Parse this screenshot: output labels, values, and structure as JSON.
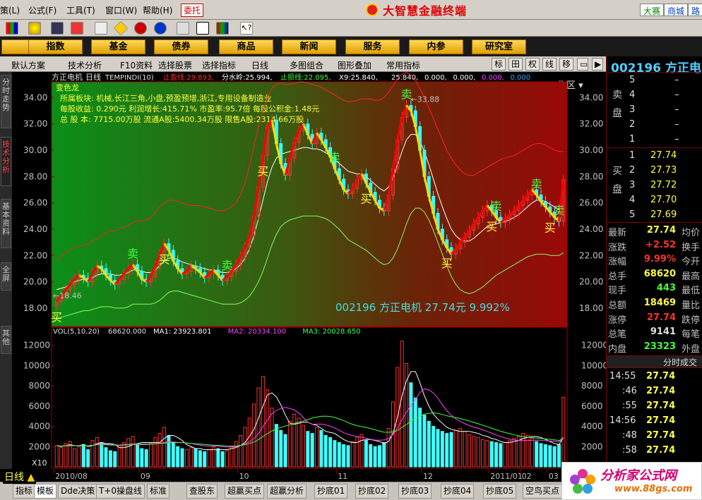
{
  "menu": {
    "items": [
      "策(L)",
      "公式(F)",
      "工具(T)",
      "窗口(W)",
      "帮助(H)"
    ],
    "weituo": "委托",
    "brand": "大智慧金融终端",
    "right_buttons": [
      "大赛",
      "商城",
      "路"
    ]
  },
  "navbar": {
    "items": [
      "指数",
      "基金",
      "债券",
      "商品",
      "新闻",
      "服务",
      "内参",
      "研究室"
    ],
    "workarea": "工作区"
  },
  "toolbar2": {
    "left_items": [
      "默认方案",
      "技术分析",
      "F10资料",
      "选择股票",
      "选择指标"
    ],
    "period": "日线",
    "mid_items": [
      "多图组合",
      "图形叠加",
      "常用指标"
    ],
    "right_buttons": [
      "标",
      "田",
      "权",
      "线",
      "移"
    ]
  },
  "side_tabs": [
    "分时走势",
    "技术分析",
    "基本资料",
    "全屏",
    "其他"
  ],
  "main_chart": {
    "header": {
      "name": "方正电机",
      "period": "日线",
      "indicator": "TEMPINDI(10)",
      "items": [
        {
          "label": "止盈线:",
          "value": "29.893",
          "color": "#ff3030"
        },
        {
          "label": "分水岭:",
          "value": "25.994",
          "color": "#ffffff"
        },
        {
          "label": "止损线:",
          "value": "22.095",
          "color": "#40ff40"
        },
        {
          "label": "X9:",
          "value": "25.840",
          "color": "#ffffff"
        },
        {
          "label": "",
          "value": "25.840",
          "color": "#ffffff"
        },
        {
          "label": "",
          "value": "0.000",
          "color": "#ffffff"
        },
        {
          "label": "",
          "value": "0.000",
          "color": "#ffffff"
        },
        {
          "label": "",
          "value": "0.000",
          "color": "#ff40ff"
        },
        {
          "label": "",
          "value": "0.000",
          "color": "#40a0ff"
        }
      ]
    },
    "info_lines": [
      "变色龙",
      "所属板块: 机械,长江三角,小盘,预盈预增,浙江,专用设备制造业",
      "每股收益: 0.290元   利润增长:415.71%   市盈率:95.7倍   每股公积金:1.48元",
      "总 股 本: 7715.00万股  流通A股:5400.34万股  限售A股:2314.66万股"
    ],
    "stock_label": "002196 方正电机 27.74元 9.992%",
    "low_mark": "←18.46",
    "high_mark": "←33.88",
    "buy_label": "买",
    "sell_label": "卖"
  },
  "chart_data": [
    {
      "type": "candlestick",
      "title": "方正电机 日线 TEMPINDI(10)",
      "y_ticks": [
        18.0,
        20.0,
        22.0,
        24.0,
        26.0,
        28.0,
        30.0,
        32.0,
        34.0
      ],
      "ylim": [
        16.6,
        35.2
      ],
      "x_months": [
        "2010/08",
        "09",
        "10",
        "11",
        "12",
        "2011/01",
        "02",
        "03"
      ],
      "close": [
        18.5,
        18.9,
        19.4,
        19.8,
        20.2,
        20.5,
        20.3,
        20.0,
        20.6,
        21.2,
        21.0,
        20.5,
        20.1,
        19.8,
        20.2,
        20.6,
        21.0,
        21.3,
        20.8,
        20.2,
        20.0,
        20.4,
        21.2,
        22.1,
        22.9,
        22.4,
        21.6,
        21.0,
        20.6,
        20.8,
        21.2,
        21.0,
        20.7,
        20.3,
        20.6,
        20.9,
        20.5,
        20.1,
        20.4,
        20.8,
        21.3,
        21.9,
        22.6,
        23.5,
        25.0,
        27.2,
        29.6,
        31.8,
        32.3,
        30.5,
        29.0,
        28.1,
        29.4,
        30.6,
        31.5,
        32.0,
        31.2,
        30.5,
        31.3,
        30.8,
        30.2,
        29.5,
        28.6,
        27.8,
        27.0,
        26.7,
        27.1,
        27.8,
        28.2,
        27.5,
        26.8,
        26.2,
        25.6,
        25.4,
        26.6,
        28.6,
        30.8,
        32.5,
        33.4,
        33.0,
        31.8,
        30.0,
        28.0,
        26.5,
        25.2,
        24.0,
        23.2,
        22.6,
        22.1,
        22.5,
        23.0,
        23.4,
        23.9,
        24.4,
        24.9,
        25.4,
        25.8,
        25.4,
        24.9,
        24.5,
        24.8,
        25.1,
        25.4,
        25.8,
        26.2,
        26.6,
        27.0,
        26.6,
        26.1,
        25.7,
        25.3,
        24.9,
        24.6,
        27.74
      ],
      "upper_band": [
        21.6,
        21.9,
        22.2,
        22.4,
        22.6,
        22.7,
        22.8,
        22.9,
        23.1,
        23.3,
        23.5,
        23.7,
        23.9,
        23.9,
        24.0,
        24.1,
        24.3,
        24.5,
        24.6,
        24.6,
        24.7,
        24.9,
        25.3,
        25.7,
        26.0,
        26.2,
        26.2,
        26.1,
        26.0,
        25.9,
        25.8,
        25.8,
        25.8,
        25.7,
        25.6,
        25.5,
        25.4,
        25.4,
        25.5,
        25.7,
        26.0,
        26.6,
        27.5,
        28.8,
        30.3,
        31.8,
        33.0,
        34.0,
        34.7,
        35.0,
        35.1,
        35.0,
        35.0,
        35.1,
        35.2,
        35.2,
        35.1,
        35.0,
        34.9,
        34.8,
        34.6,
        34.4,
        34.2,
        34.0,
        33.8,
        33.7,
        33.7,
        33.8,
        33.9,
        33.9,
        33.9,
        33.8,
        33.8,
        34.0,
        34.4,
        34.9,
        35.4,
        35.8,
        35.9,
        35.7,
        35.3,
        34.7,
        34.0,
        33.2,
        32.4,
        31.6,
        30.8,
        30.0,
        29.4,
        28.9,
        28.5,
        28.2,
        28.1,
        28.1,
        28.3,
        28.5,
        28.7,
        28.9,
        29.1,
        29.3,
        29.4,
        29.5,
        29.6,
        29.8,
        30.0,
        30.2,
        30.4,
        30.5,
        30.5,
        30.4,
        30.2,
        30.0,
        29.9,
        29.9
      ],
      "mid_line": [
        19.4,
        19.5,
        19.6,
        19.8,
        20.0,
        20.1,
        20.2,
        20.2,
        20.3,
        20.5,
        20.6,
        20.6,
        20.6,
        20.5,
        20.5,
        20.6,
        20.7,
        20.9,
        20.9,
        20.8,
        20.7,
        20.7,
        20.9,
        21.2,
        21.6,
        21.8,
        21.8,
        21.7,
        21.5,
        21.4,
        21.3,
        21.2,
        21.1,
        21.0,
        20.9,
        20.9,
        20.8,
        20.7,
        20.7,
        20.8,
        21.0,
        21.3,
        21.8,
        22.5,
        23.5,
        24.8,
        26.2,
        27.6,
        28.7,
        29.4,
        29.7,
        29.8,
        29.9,
        30.0,
        30.1,
        30.2,
        30.2,
        30.1,
        30.1,
        30.0,
        29.8,
        29.6,
        29.3,
        29.0,
        28.7,
        28.4,
        28.3,
        28.2,
        28.2,
        28.0,
        27.7,
        27.4,
        27.1,
        26.9,
        27.2,
        27.9,
        28.9,
        29.9,
        30.8,
        31.2,
        31.2,
        30.7,
        29.9,
        28.9,
        27.8,
        26.7,
        25.7,
        24.8,
        24.0,
        23.5,
        23.2,
        23.1,
        23.1,
        23.3,
        23.6,
        23.9,
        24.2,
        24.3,
        24.4,
        24.5,
        24.6,
        24.7,
        24.9,
        25.1,
        25.4,
        25.7,
        26.0,
        26.2,
        26.2,
        26.1,
        25.9,
        25.7,
        25.5,
        25.8
      ],
      "lower_band": [
        17.2,
        17.3,
        17.4,
        17.5,
        17.6,
        17.7,
        17.8,
        17.8,
        17.9,
        18.0,
        18.1,
        18.1,
        18.1,
        18.0,
        18.0,
        18.0,
        18.1,
        18.3,
        18.3,
        18.3,
        18.3,
        18.3,
        18.4,
        18.6,
        18.9,
        19.2,
        19.3,
        19.3,
        19.2,
        19.1,
        19.0,
        18.9,
        18.8,
        18.7,
        18.6,
        18.5,
        18.4,
        18.3,
        18.3,
        18.3,
        18.3,
        18.4,
        18.6,
        18.9,
        19.4,
        20.0,
        20.8,
        21.8,
        22.8,
        23.6,
        24.2,
        24.5,
        24.7,
        24.8,
        24.9,
        25.0,
        25.0,
        25.0,
        25.0,
        24.9,
        24.8,
        24.6,
        24.3,
        24.0,
        23.6,
        23.2,
        23.0,
        22.8,
        22.6,
        22.4,
        22.1,
        21.8,
        21.5,
        21.3,
        21.4,
        21.8,
        22.5,
        23.4,
        24.4,
        25.2,
        25.6,
        25.6,
        25.3,
        24.7,
        23.9,
        23.0,
        22.1,
        21.2,
        20.4,
        19.8,
        19.4,
        19.2,
        19.1,
        19.2,
        19.4,
        19.6,
        19.9,
        20.2,
        20.5,
        20.7,
        20.9,
        21.1,
        21.3,
        21.5,
        21.7,
        21.9,
        22.0,
        22.1,
        22.1,
        22.1,
        22.0,
        22.0,
        22.0,
        22.2
      ],
      "buy_points": [
        0,
        24,
        46,
        69,
        87,
        97,
        110
      ],
      "sell_points": [
        17,
        38,
        62,
        78,
        98,
        107,
        112
      ]
    },
    {
      "type": "bar",
      "title": "VOL(5,10,20)",
      "series": [
        {
          "name": "VOL",
          "last": "68620.000"
        },
        {
          "name": "MA1",
          "last": "23923.801"
        },
        {
          "name": "MA2",
          "last": "20334.100"
        },
        {
          "name": "MA3",
          "last": "20028.650"
        }
      ],
      "y_ticks": [
        2000,
        4000,
        6000,
        8000,
        10000,
        12000
      ],
      "ylim": [
        0,
        12800
      ],
      "unit_label": "X10",
      "values": [
        2100,
        1900,
        2300,
        2500,
        1800,
        2000,
        2200,
        1700,
        2600,
        2900,
        2400,
        1900,
        1600,
        1500,
        2100,
        2400,
        2800,
        3000,
        2200,
        1800,
        1700,
        2300,
        2900,
        3300,
        3900,
        3100,
        2400,
        2000,
        1800,
        1700,
        1900,
        1800,
        1600,
        1500,
        1700,
        2000,
        1800,
        1500,
        1600,
        2000,
        2500,
        3100,
        3900,
        4800,
        6200,
        7800,
        8900,
        7600,
        5800,
        4200,
        3600,
        3200,
        4500,
        5200,
        4800,
        4100,
        3500,
        3300,
        3900,
        3600,
        3100,
        2900,
        2600,
        2400,
        2200,
        2100,
        2500,
        2900,
        3200,
        2600,
        2200,
        2000,
        2100,
        2400,
        3800,
        6400,
        9800,
        12400,
        10200,
        8300,
        6800,
        5800,
        5100,
        4500,
        4000,
        3700,
        3500,
        3300,
        3400,
        3600,
        3800,
        3500,
        3200,
        3000,
        2900,
        2700,
        2600,
        2500,
        2400,
        2300,
        2400,
        2600,
        2800,
        3000,
        3300,
        3100,
        2800,
        2500,
        2300,
        2200,
        2100,
        2000,
        2200,
        6862
      ],
      "ma1": [
        2100,
        2000,
        2100,
        2200,
        2100,
        2100,
        2200,
        2000,
        2100,
        2300,
        2400,
        2300,
        2300,
        2200,
        1900,
        1900,
        2000,
        2200,
        2300,
        2400,
        2400,
        2400,
        2400,
        2400,
        2800,
        3100,
        3100,
        2900,
        2600,
        2200,
        2000,
        1800,
        1800,
        1700,
        1700,
        1700,
        1700,
        1700,
        1700,
        1800,
        1900,
        2100,
        2400,
        3000,
        3700,
        4800,
        6000,
        7100,
        7300,
        6900,
        6100,
        5100,
        4300,
        4200,
        4300,
        4400,
        4400,
        4200,
        4100,
        3800,
        3500,
        3400,
        3300,
        3000,
        2700,
        2500,
        2400,
        2400,
        2600,
        2700,
        2700,
        2600,
        2500,
        2300,
        2500,
        3300,
        4900,
        7000,
        8500,
        9400,
        9400,
        8300,
        7000,
        6000,
        5200,
        4700,
        4300,
        3900,
        3700,
        3600,
        3500,
        3500,
        3500,
        3400,
        3300,
        3100,
        3000,
        2800,
        2700,
        2500,
        2400,
        2400,
        2500,
        2600,
        2800,
        2900,
        3000,
        3000,
        2900,
        2700,
        2500,
        2300,
        2200,
        2900
      ],
      "ma2": [
        2100,
        2050,
        2100,
        2150,
        2100,
        2100,
        2110,
        2070,
        2130,
        2230,
        2260,
        2240,
        2200,
        2180,
        2140,
        2130,
        2170,
        2210,
        2200,
        2190,
        2180,
        2240,
        2290,
        2320,
        2410,
        2480,
        2460,
        2420,
        2400,
        2340,
        2300,
        2220,
        2150,
        2080,
        2060,
        2060,
        2040,
        1990,
        1960,
        1960,
        1990,
        2110,
        2270,
        2490,
        2780,
        3270,
        3960,
        4640,
        5240,
        5580,
        5760,
        5860,
        5760,
        5600,
        5300,
        4860,
        4400,
        4200,
        4220,
        4220,
        4140,
        4020,
        3840,
        3610,
        3370,
        3200,
        3080,
        3000,
        2930,
        2820,
        2720,
        2640,
        2630,
        2650,
        2800,
        3190,
        3800,
        4640,
        5400,
        6080,
        6670,
        7320,
        7700,
        7590,
        7290,
        6790,
        6120,
        5530,
        5090,
        4730,
        4480,
        4270,
        4080,
        3920,
        3810,
        3660,
        3500,
        3320,
        3150,
        2980,
        2850,
        2740,
        2660,
        2600,
        2600,
        2600,
        2620,
        2640,
        2620,
        2580,
        2550,
        2520,
        2470,
        2920
      ],
      "ma3": [
        2100,
        2050,
        2070,
        2090,
        2080,
        2090,
        2100,
        2080,
        2120,
        2180,
        2200,
        2180,
        2150,
        2150,
        2160,
        2180,
        2210,
        2250,
        2250,
        2240,
        2240,
        2250,
        2270,
        2300,
        2340,
        2380,
        2400,
        2390,
        2380,
        2360,
        2320,
        2280,
        2250,
        2210,
        2170,
        2140,
        2120,
        2090,
        2060,
        2050,
        2060,
        2110,
        2180,
        2300,
        2450,
        2690,
        2990,
        3280,
        3540,
        3730,
        3890,
        4030,
        4140,
        4290,
        4400,
        4520,
        4650,
        4810,
        4910,
        4990,
        5000,
        4970,
        4870,
        4730,
        4560,
        4360,
        4190,
        4060,
        3970,
        3890,
        3780,
        3650,
        3530,
        3420,
        3410,
        3460,
        3580,
        3890,
        4190,
        4490,
        4750,
        5000,
        5200,
        5280,
        5320,
        5280,
        5160,
        5040,
        4940,
        4860,
        4760,
        4650,
        4520,
        4380,
        4250,
        4110,
        3960,
        3810,
        3660,
        3510,
        3390,
        3270,
        3160,
        3060,
        2990,
        2930,
        2880,
        2840,
        2800,
        2760,
        2710,
        2660,
        2600,
        2790
      ]
    }
  ],
  "right_panel": {
    "code": "002196 方正电",
    "sell_label": "卖盘",
    "buy_label": "买盘",
    "sell": [
      {
        "n": "5",
        "price": "–",
        "vol": ""
      },
      {
        "n": "4",
        "price": "–",
        "vol": ""
      },
      {
        "n": "3",
        "price": "–",
        "vol": ""
      },
      {
        "n": "2",
        "price": "–",
        "vol": ""
      },
      {
        "n": "1",
        "price": "–",
        "vol": ""
      }
    ],
    "buy": [
      {
        "n": "1",
        "price": "27.74",
        "vol": ""
      },
      {
        "n": "2",
        "price": "27.73",
        "vol": ""
      },
      {
        "n": "3",
        "price": "27.72",
        "vol": ""
      },
      {
        "n": "4",
        "price": "27.70",
        "vol": ""
      },
      {
        "n": "5",
        "price": "27.69",
        "vol": ""
      }
    ],
    "stats": [
      {
        "label": "最新",
        "value": "27.74",
        "color": "yel",
        "tail": "均价"
      },
      {
        "label": "涨跌",
        "value": "+2.52",
        "color": "red",
        "tail": "换手"
      },
      {
        "label": "涨幅",
        "value": "9.99%",
        "color": "red",
        "tail": "今开"
      },
      {
        "label": "总手",
        "value": "68620",
        "color": "yel",
        "tail": "最高"
      },
      {
        "label": "现手",
        "value": "443",
        "color": "grn",
        "tail": "最低"
      },
      {
        "label": "总额",
        "value": "18469",
        "color": "yel",
        "tail": "量比"
      },
      {
        "label": "涨停",
        "value": "27.74",
        "color": "red",
        "tail": "跌停"
      },
      {
        "label": "总笔",
        "value": "9141",
        "color": "wht",
        "tail": "每笔"
      },
      {
        "label": "内盘",
        "value": "23323",
        "color": "grn",
        "tail": "外盘"
      }
    ],
    "fenshi_title": "分时成交",
    "ticks": [
      {
        "time": "14:55",
        "price": "27.74"
      },
      {
        "time": ":46",
        "price": "27.74"
      },
      {
        "time": ":55",
        "price": "27.74"
      },
      {
        "time": "14:56",
        "price": "27.74"
      },
      {
        "time": ":48",
        "price": "27.74"
      },
      {
        "time": ":58",
        "price": "27.74"
      }
    ]
  },
  "bottom_tabs": {
    "period": "日线",
    "items": [
      "指标",
      "模板",
      "Dde决策",
      "T+0操盘线",
      "标准",
      "查股东",
      "超赢买点",
      "超赢分析",
      "抄底01",
      "抄底02",
      "抄底03",
      "抄底04",
      "抄底05",
      "空鸟买点"
    ]
  },
  "watermark": {
    "title": "分析家公式网",
    "url": "www.88gs.com"
  }
}
